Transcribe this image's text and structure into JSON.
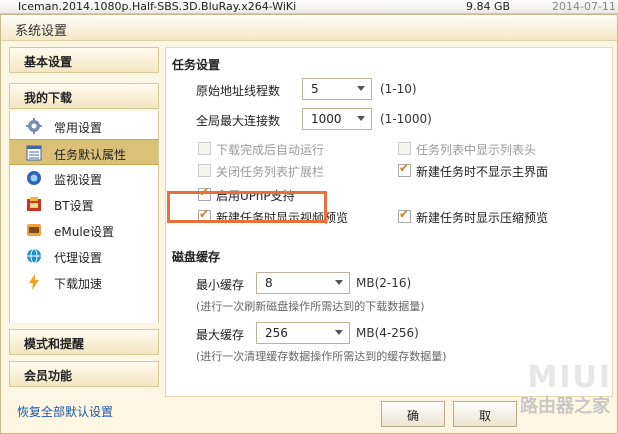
{
  "background_row": {
    "filename": "Iceman.2014.1080p.Half-SBS.3D.BluRay.x264-WiKi",
    "size": "9.84 GB",
    "date": "2014-07-11"
  },
  "dialog": {
    "title": "系统设置"
  },
  "sidebar": {
    "basic": "基本设置",
    "my_download": "我的下载",
    "items": [
      {
        "label": "常用设置",
        "icon": "gear-icon"
      },
      {
        "label": "任务默认属性",
        "icon": "list-icon"
      },
      {
        "label": "监视设置",
        "icon": "monitor-icon"
      },
      {
        "label": "BT设置",
        "icon": "bt-icon"
      },
      {
        "label": "eMule设置",
        "icon": "emule-icon"
      },
      {
        "label": "代理设置",
        "icon": "proxy-icon"
      },
      {
        "label": "下载加速",
        "icon": "bolt-icon"
      }
    ],
    "mode": "模式和提醒",
    "member": "会员功能",
    "restore": "恢复全部默认设置"
  },
  "task": {
    "heading": "任务设置",
    "origin_threads_label": "原始地址线程数",
    "origin_threads_value": "5",
    "origin_threads_range": "(1-10)",
    "max_conn_label": "全局最大连接数",
    "max_conn_value": "1000",
    "max_conn_range": "(1-1000)",
    "options": [
      {
        "label": "下载完成后自动运行",
        "checked": false,
        "disabled": true
      },
      {
        "label": "任务列表中显示列表头",
        "checked": false,
        "disabled": true
      },
      {
        "label": "关闭任务列表扩展栏",
        "checked": false,
        "disabled": true
      },
      {
        "label": "新建任务时不显示主界面",
        "checked": true,
        "disabled": false
      },
      {
        "label": "启用UPnP支持",
        "checked": true,
        "disabled": false
      },
      {
        "label": "新建任务时显示视频预览",
        "checked": true,
        "disabled": false
      },
      {
        "label": "新建任务时显示压缩预览",
        "checked": true,
        "disabled": false
      }
    ]
  },
  "cache": {
    "heading": "磁盘缓存",
    "min_label": "最小缓存",
    "min_value": "8",
    "min_range": "MB(2-16)",
    "min_hint": "(进行一次刷新磁盘操作所需达到的下载数据量)",
    "max_label": "最大缓存",
    "max_value": "256",
    "max_range": "MB(4-256)",
    "max_hint": "(进行一次清理缓存数据操作所需达到的缓存数据量)"
  },
  "buttons": {
    "ok": "确",
    "cancel": "取"
  },
  "watermark": {
    "line1": "MIUI",
    "line2": "路由器之家"
  },
  "colors": {
    "highlight": "#e8703a",
    "active_item": "#dbc077",
    "check": "#d57a14",
    "link": "#1a57a8"
  }
}
